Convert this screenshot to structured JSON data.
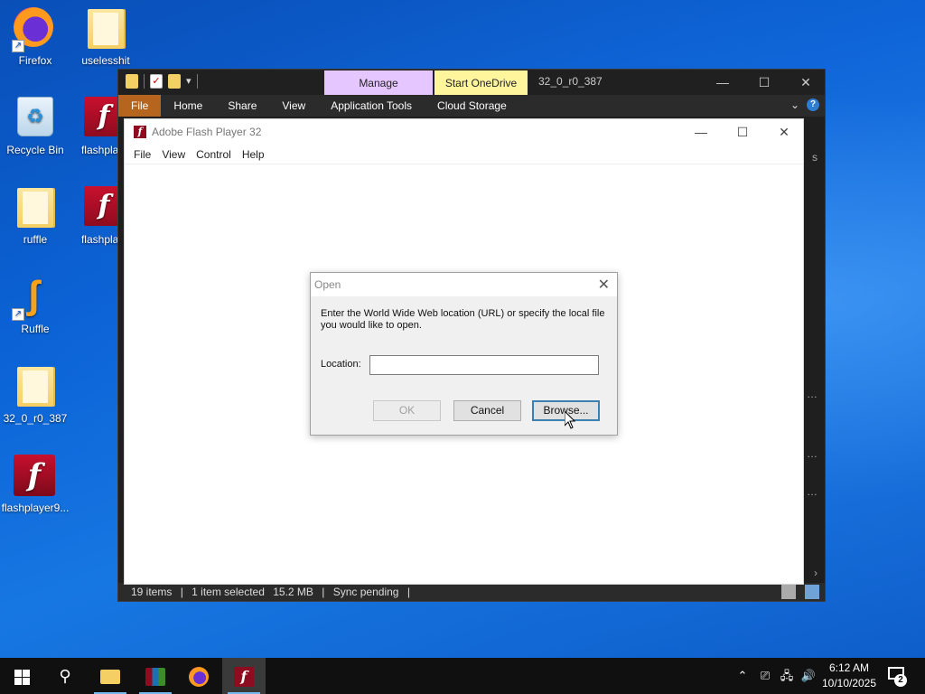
{
  "desktop": {
    "icons": [
      {
        "label": "Firefox",
        "icon": "firefox-icon"
      },
      {
        "label": "uselesshit",
        "icon": "folder-icon"
      },
      {
        "label": "Recycle Bin",
        "icon": "recycle-bin-icon"
      },
      {
        "label": "flashplaye",
        "icon": "winrar-icon"
      },
      {
        "label": "ruffle",
        "icon": "folder-icon"
      },
      {
        "label": "flashplaye",
        "icon": "winrar-icon"
      },
      {
        "label": "Ruffle",
        "icon": "ruffle-icon"
      },
      {
        "label": "32_0_r0_387",
        "icon": "folder-icon"
      },
      {
        "label": "flashplayer9...",
        "icon": "flash-icon"
      }
    ]
  },
  "explorer": {
    "title": "32_0_r0_387",
    "contextual_tabs": {
      "manage": "Manage",
      "start_onedrive": "Start OneDrive"
    },
    "ribbon": [
      "File",
      "Home",
      "Share",
      "View",
      "Application Tools",
      "Cloud Storage"
    ],
    "status": {
      "items": "19 items",
      "selected": "1 item selected",
      "size": "15.2 MB",
      "sync": "Sync pending"
    },
    "colors": {
      "manage_tab": "#e6c6ff",
      "onedrive_tab": "#fff59d",
      "file_tab": "#b5651d"
    }
  },
  "flash_player": {
    "title": "Adobe Flash Player 32",
    "menu": [
      "File",
      "View",
      "Control",
      "Help"
    ]
  },
  "open_dialog": {
    "title": "Open",
    "message": "Enter the World Wide Web location (URL) or specify the local file you would like to open.",
    "location_label": "Location:",
    "location_value": "",
    "ok": "OK",
    "cancel": "Cancel",
    "browse": "Browse..."
  },
  "taskbar": {
    "time": "6:12 AM",
    "date": "10/10/2025",
    "notification_count": "2"
  }
}
